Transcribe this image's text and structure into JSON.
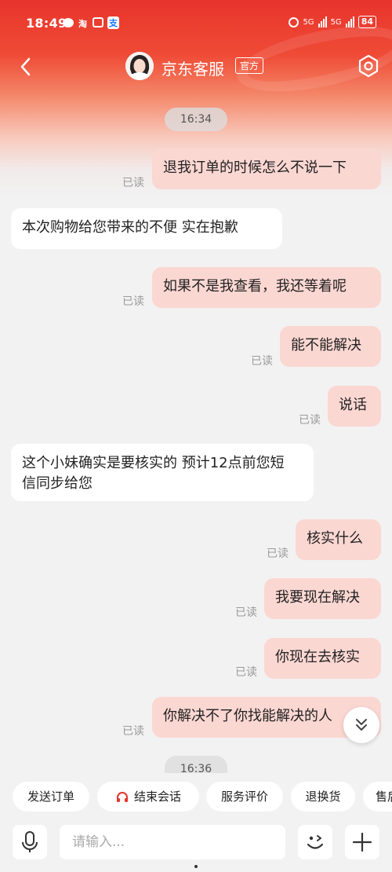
{
  "status": {
    "time": "18:49",
    "battery": "84",
    "net1": "5G",
    "net2": "5G",
    "app_taobao": "淘",
    "app_alipay": "支"
  },
  "header": {
    "title": "京东客服",
    "badge": "官方"
  },
  "timestamps": [
    "16:34",
    "16:36"
  ],
  "read_label": "已读",
  "messages": [
    {
      "from": "me",
      "text": "退我订单的时候怎么不说一下"
    },
    {
      "from": "agent",
      "text": "本次购物给您带来的不便  实在抱歉"
    },
    {
      "from": "me",
      "text": "如果不是我查看，我还等着呢"
    },
    {
      "from": "me",
      "text": "能不能解决"
    },
    {
      "from": "me",
      "text": "说话"
    },
    {
      "from": "agent",
      "text": "这个小妹确实是要核实的  预计12点前您短信同步给您"
    },
    {
      "from": "me",
      "text": "核实什么"
    },
    {
      "from": "me",
      "text": "我要现在解决"
    },
    {
      "from": "me",
      "text": "你现在去核实"
    },
    {
      "from": "me",
      "text": "你解决不了你找能解决的人"
    }
  ],
  "quick_actions": [
    "发送订单",
    "结束会话",
    "服务评价",
    "退换货",
    "售后"
  ],
  "input": {
    "placeholder": "请输入..."
  },
  "colors": {
    "brand": "#e8342c",
    "my_bubble": "#fbd7d2",
    "agent_bubble": "#ffffff"
  }
}
